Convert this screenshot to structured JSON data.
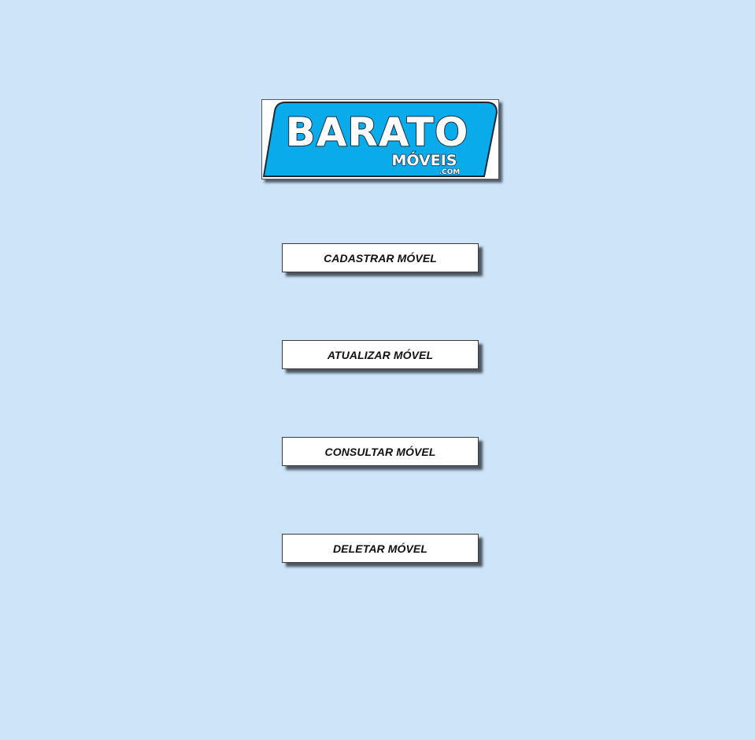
{
  "logo": {
    "word_main": "BARATO",
    "word_sub": "MÓVEIS",
    "word_domain": ".COM",
    "colors": {
      "badge": "#0aabea",
      "outline": "#1a2a38",
      "text": "#ffffff"
    }
  },
  "menu": {
    "buttons": [
      {
        "label": "CADASTRAR MÓVEL"
      },
      {
        "label": "ATUALIZAR MÓVEL"
      },
      {
        "label": "CONSULTAR MÓVEL"
      },
      {
        "label": "DELETAR MÓVEL"
      }
    ]
  },
  "colors": {
    "background": "#cde4f9",
    "button_background": "#ffffff",
    "button_text": "#111111"
  }
}
